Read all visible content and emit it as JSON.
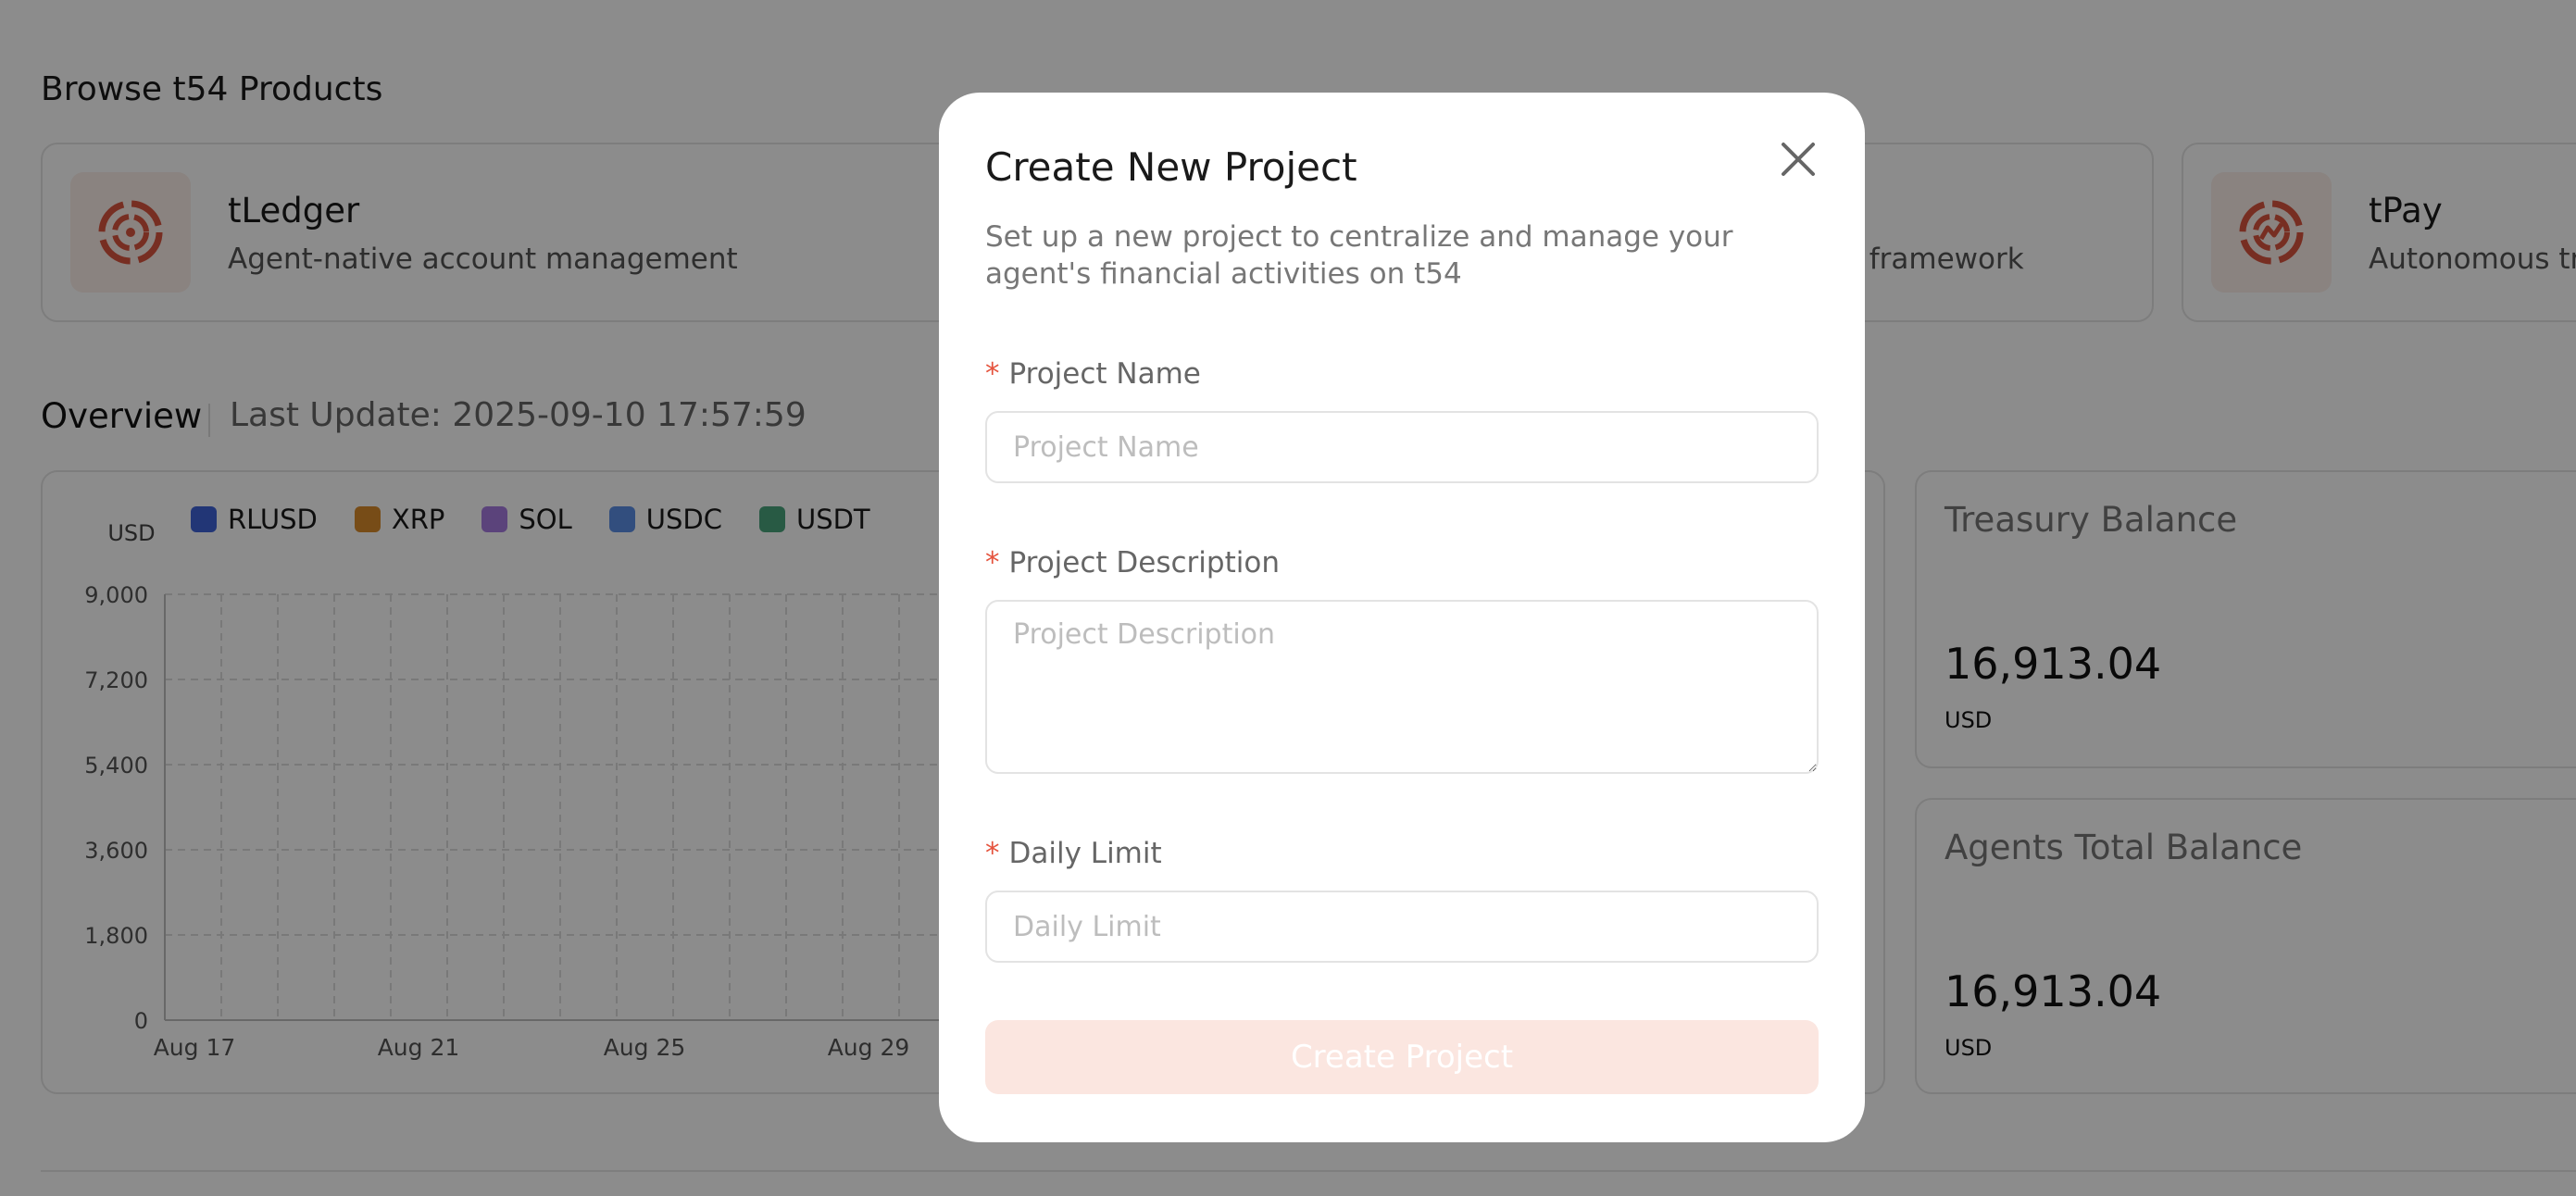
{
  "browse": {
    "title": "Browse t54 Products",
    "products": [
      {
        "name": "tLedger",
        "description": "Agent-native account management"
      },
      {
        "name": "",
        "description": "ent framework"
      },
      {
        "name": "tPay",
        "description": "Autonomous tr"
      }
    ]
  },
  "overview": {
    "title": "Overview",
    "last_update": "Last Update: 2025-09-10 17:57:59"
  },
  "chart_data": {
    "type": "line",
    "legend": [
      {
        "name": "RLUSD",
        "color": "#3f63d8"
      },
      {
        "name": "XRP",
        "color": "#d98b2b"
      },
      {
        "name": "SOL",
        "color": "#a77be0"
      },
      {
        "name": "USDC",
        "color": "#5b8ee6"
      },
      {
        "name": "USDT",
        "color": "#4aa57d"
      }
    ],
    "ylabel": "USD",
    "y_ticks": [
      "9,000",
      "7,200",
      "5,400",
      "3,600",
      "1,800",
      "0"
    ],
    "ylim": [
      0,
      9000
    ],
    "x_ticks": [
      "Aug 17",
      "Aug 21",
      "Aug 25",
      "Aug 29"
    ],
    "grid": true
  },
  "stats": [
    {
      "title": "Treasury Balance",
      "value": "16,913.04",
      "unit": "USD"
    },
    {
      "title": "Agents Total Balance",
      "value": "16,913.04",
      "unit": "USD"
    }
  ],
  "modal": {
    "title": "Create New Project",
    "description": "Set up a new project to centralize and manage your agent's financial activities on t54",
    "required_mark": "*",
    "fields": {
      "name_label": "Project Name",
      "name_placeholder": "Project Name",
      "description_label": "Project Description",
      "description_placeholder": "Project Description",
      "limit_label": "Daily Limit",
      "limit_placeholder": "Daily Limit"
    },
    "submit_label": "Create Project",
    "close_icon": "close-icon"
  },
  "colors": {
    "accent": "#d9553f",
    "button_disabled_bg": "#fbe6e0",
    "overlay": "rgba(0,0,0,0.45)"
  }
}
